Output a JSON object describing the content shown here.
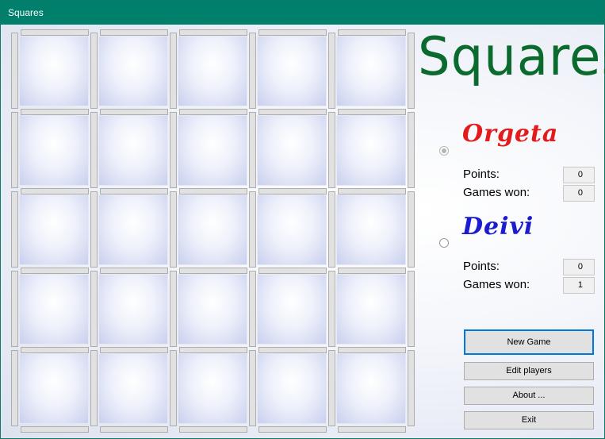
{
  "window": {
    "title": "Squares"
  },
  "logo": {
    "text": "Squares",
    "color": "#0b6b2e"
  },
  "board": {
    "rows": 5,
    "cols": 5
  },
  "players": [
    {
      "name": "Orgeta",
      "color": "#e31b1b",
      "active": true,
      "points_label": "Points:",
      "points": "0",
      "games_label": "Games won:",
      "games_won": "0"
    },
    {
      "name": "Deivi",
      "color": "#1b1bcf",
      "active": false,
      "points_label": "Points:",
      "points": "0",
      "games_label": "Games won:",
      "games_won": "1"
    }
  ],
  "buttons": {
    "new_game": "New Game",
    "edit_players": "Edit players",
    "about": "About ...",
    "exit": "Exit"
  }
}
